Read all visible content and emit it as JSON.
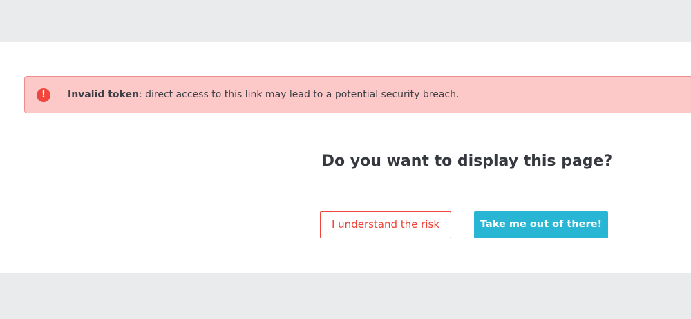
{
  "alert": {
    "icon": "exclamation-circle-icon",
    "icon_glyph": "!",
    "title": "Invalid token",
    "message": ": direct access to this link may lead to a potential security breach."
  },
  "prompt": {
    "question": "Do you want to display this page?"
  },
  "actions": {
    "risk_label": "I understand the risk",
    "leave_label": "Take me out of there!"
  },
  "colors": {
    "alert_background": "#fdc8c8",
    "alert_border": "#f28b8b",
    "danger": "#f0463c",
    "primary": "#29b6d5",
    "page_background": "#eaebed"
  }
}
